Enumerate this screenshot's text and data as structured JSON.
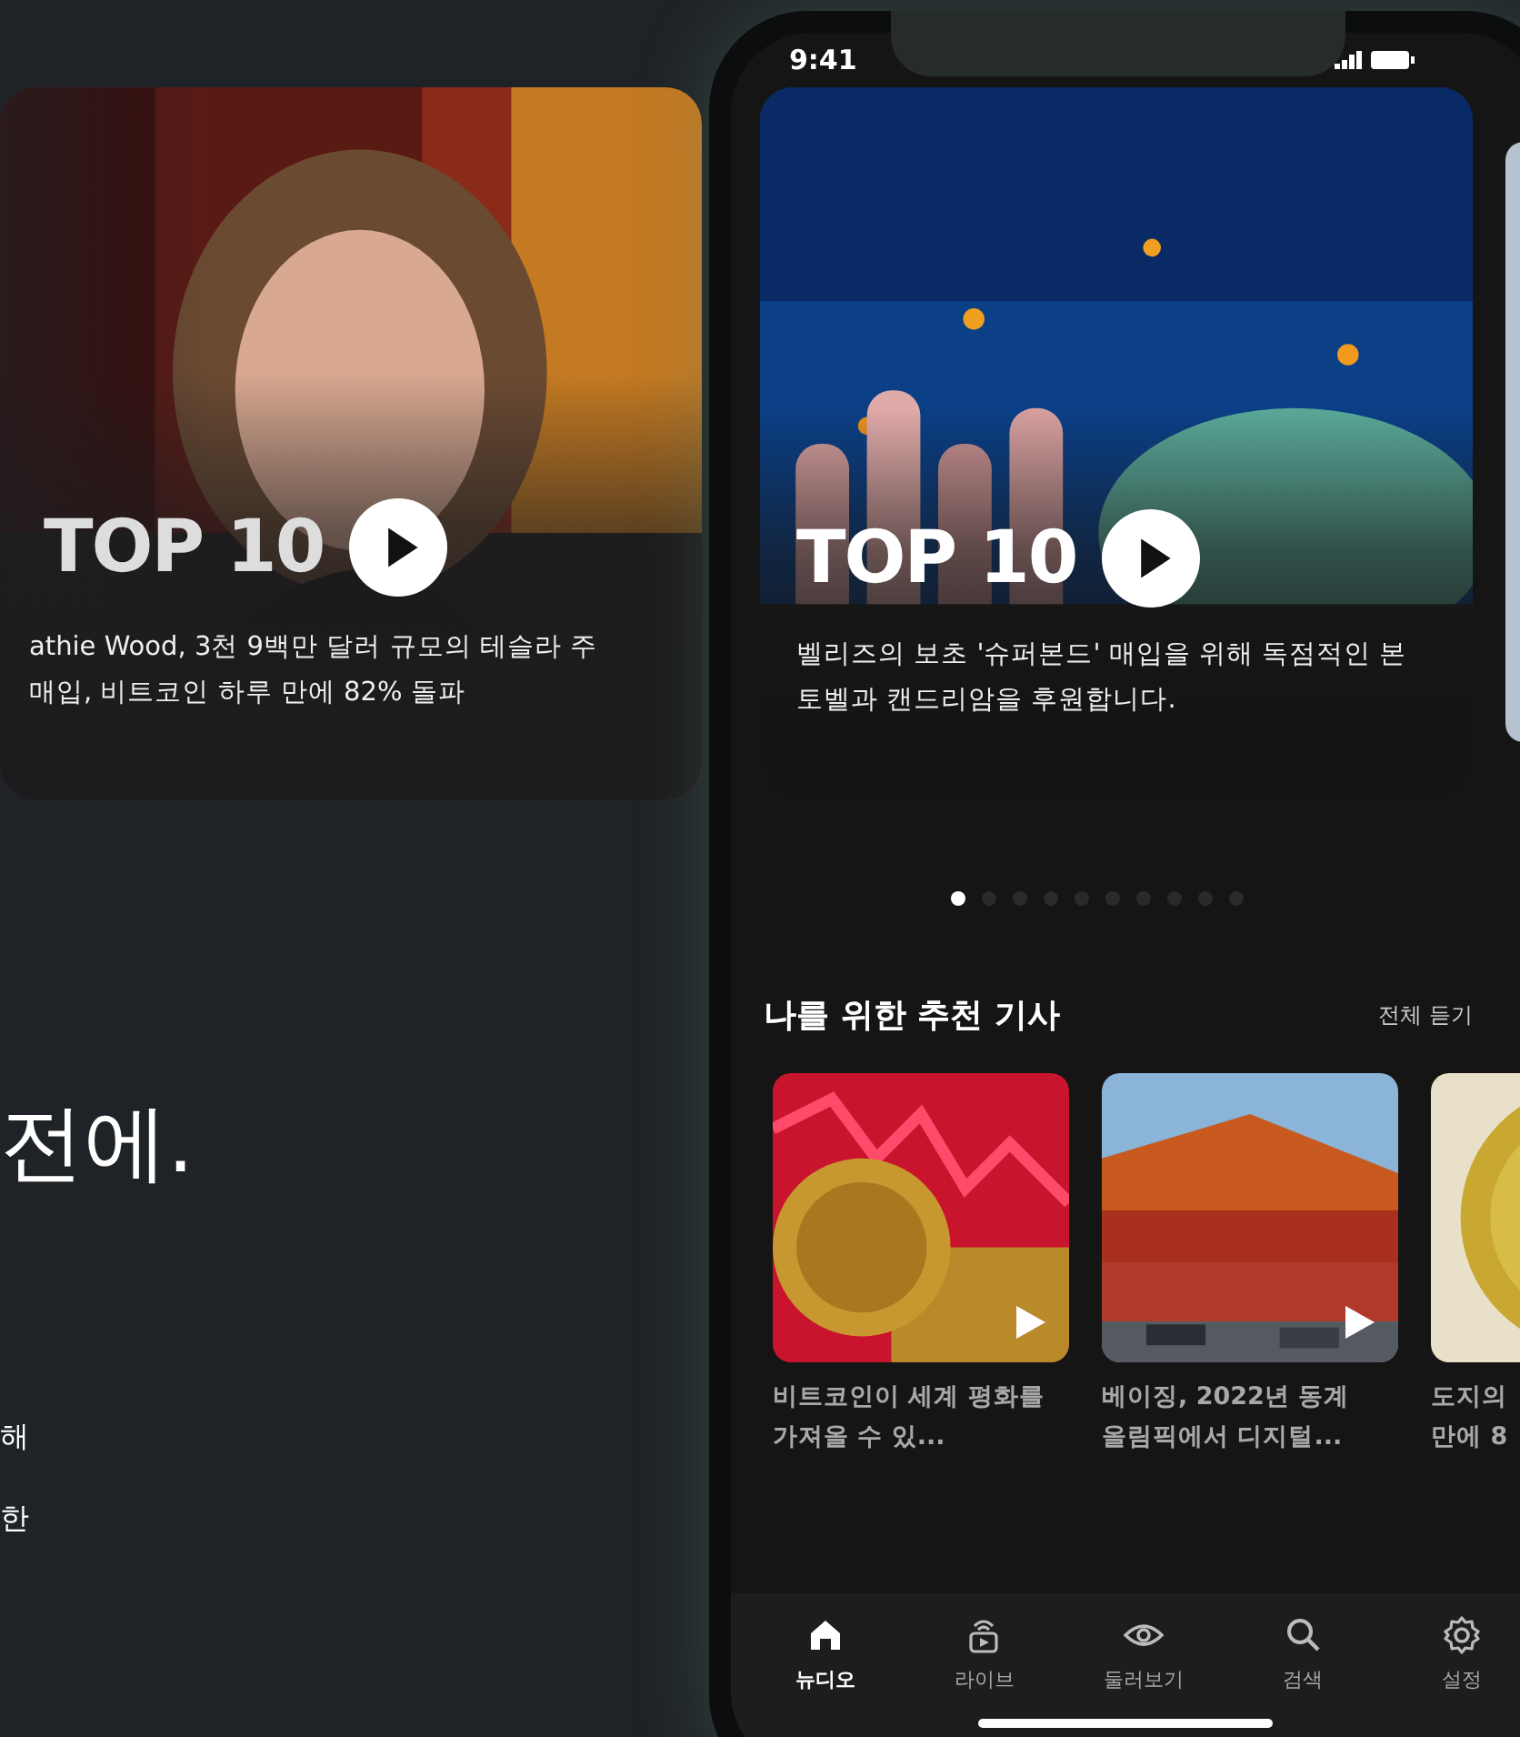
{
  "background": {
    "headline": "전에.",
    "fragments": [
      "해",
      "한"
    ]
  },
  "feature_card": {
    "badge": "TOP 10",
    "caption_lines": [
      "athie Wood, 3천 9백만 달러 규모의 테슬라 주",
      "매입, 비트코인 하루 만에 82% 돌파"
    ]
  },
  "phone": {
    "status_bar": {
      "time": "9:41"
    },
    "carousel": {
      "badge": "TOP 10",
      "caption_lines": [
        "벨리즈의 보초 '슈퍼본드' 매입을 위해 독점적인 본",
        "토벨과 캔드리암을 후원합니다."
      ],
      "dots": [
        {
          "selected": true
        },
        {
          "selected": false
        },
        {
          "selected": false
        },
        {
          "selected": false
        },
        {
          "selected": false
        },
        {
          "selected": false
        },
        {
          "selected": false
        },
        {
          "selected": false
        },
        {
          "selected": false
        },
        {
          "selected": false
        }
      ]
    },
    "recommended": {
      "title": "나를 위한 추천 기사",
      "action": "전체 듣기",
      "articles": [
        {
          "title_lines": [
            "비트코인이 세계 평화를",
            "가져올 수 있..."
          ]
        },
        {
          "title_lines": [
            "베이징, 2022년 동계",
            "올림픽에서 디지털..."
          ]
        },
        {
          "title_lines": [
            "도지의",
            "만에 8"
          ]
        }
      ]
    },
    "tab_bar": [
      {
        "label": "뉴디오",
        "selected": true
      },
      {
        "label": "라이브",
        "selected": false
      },
      {
        "label": "둘러보기",
        "selected": false
      },
      {
        "label": "검색",
        "selected": false
      },
      {
        "label": "설정",
        "selected": false
      }
    ]
  }
}
